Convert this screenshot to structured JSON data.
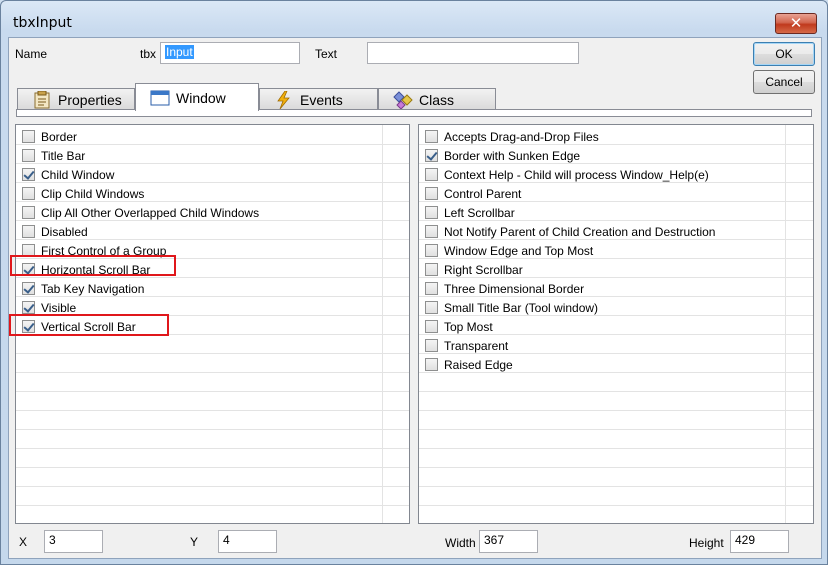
{
  "window": {
    "title": "tbxInput"
  },
  "header": {
    "name_label": "Name",
    "name_prefix": "tbx",
    "name_value": "Input",
    "text_label": "Text",
    "text_value": ""
  },
  "buttons": {
    "ok": "OK",
    "cancel": "Cancel"
  },
  "tabs": [
    {
      "label": "Properties",
      "icon": "properties-icon"
    },
    {
      "label": "Window",
      "icon": "window-icon"
    },
    {
      "label": "Events",
      "icon": "lightning-icon"
    },
    {
      "label": "Class",
      "icon": "class-icon"
    }
  ],
  "left_options": [
    {
      "label": "Border",
      "checked": false
    },
    {
      "label": "Title Bar",
      "checked": false
    },
    {
      "label": "Child Window",
      "checked": true
    },
    {
      "label": "Clip Child Windows",
      "checked": false
    },
    {
      "label": "Clip All Other Overlapped Child Windows",
      "checked": false
    },
    {
      "label": "Disabled",
      "checked": false
    },
    {
      "label": "First Control of a Group",
      "checked": false
    },
    {
      "label": "Horizontal Scroll Bar",
      "checked": true,
      "highlighted": true
    },
    {
      "label": "Tab Key Navigation",
      "checked": true
    },
    {
      "label": "Visible",
      "checked": true
    },
    {
      "label": "Vertical Scroll Bar",
      "checked": true,
      "highlighted": true
    }
  ],
  "right_options": [
    {
      "label": "Accepts Drag-and-Drop Files",
      "checked": false
    },
    {
      "label": "Border with Sunken Edge",
      "checked": true
    },
    {
      "label": "Context Help - Child will process Window_Help(e)",
      "checked": false
    },
    {
      "label": "Control Parent",
      "checked": false
    },
    {
      "label": "Left Scrollbar",
      "checked": false
    },
    {
      "label": "Not Notify Parent of Child Creation and Destruction",
      "checked": false
    },
    {
      "label": "Window Edge and Top Most",
      "checked": false
    },
    {
      "label": "Right Scrollbar",
      "checked": false
    },
    {
      "label": "Three Dimensional Border",
      "checked": false
    },
    {
      "label": "Small Title Bar (Tool window)",
      "checked": false
    },
    {
      "label": "Top Most",
      "checked": false
    },
    {
      "label": "Transparent",
      "checked": false
    },
    {
      "label": "Raised Edge",
      "checked": false
    }
  ],
  "position": {
    "x_label": "X",
    "x_value": "3",
    "y_label": "Y",
    "y_value": "4",
    "width_label": "Width",
    "width_value": "367",
    "height_label": "Height",
    "height_value": "429"
  },
  "colors": {
    "highlight": "#e0171b",
    "selection": "#3399ff"
  }
}
